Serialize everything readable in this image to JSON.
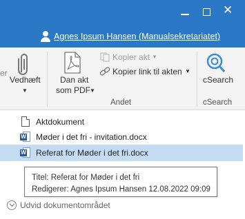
{
  "titlebar": {
    "user_name": "Agnes Ipsum Hansen (Manualsekretariatet)",
    "accent_color": "#2b78c7"
  },
  "ribbon": {
    "partial_left": "er",
    "attach": {
      "label": "Vedhæft",
      "icon": "paperclip-icon"
    },
    "pdf": {
      "line1": "Dan akt",
      "line2": "som PDF",
      "icon": "pdf-icon"
    },
    "copy_act": {
      "label": "Kopier akt",
      "enabled": false
    },
    "copy_link": {
      "label": "Kopier link til akten",
      "icon": "link-icon"
    },
    "group_other": "Andet",
    "csearch": {
      "label": "cSearch",
      "group": "cSearch",
      "icon": "csearch-icon"
    }
  },
  "documents": [
    {
      "name": "Aktdokument",
      "icon": "document-icon"
    },
    {
      "name": "Møder i det fri - invitation.docx",
      "icon": "word-icon"
    },
    {
      "name": "Referat for Møder i det fri.docx",
      "icon": "word-icon",
      "selected": true
    }
  ],
  "tooltip": {
    "title": "Titel: Referat for Møder i det fri",
    "editor": "Redigerer: Agnes Ipsum Hansen 12.08.2022 09:09"
  },
  "expand": {
    "label": "Udvid dokumentområdet"
  },
  "selection_color": "#c5dcf5"
}
